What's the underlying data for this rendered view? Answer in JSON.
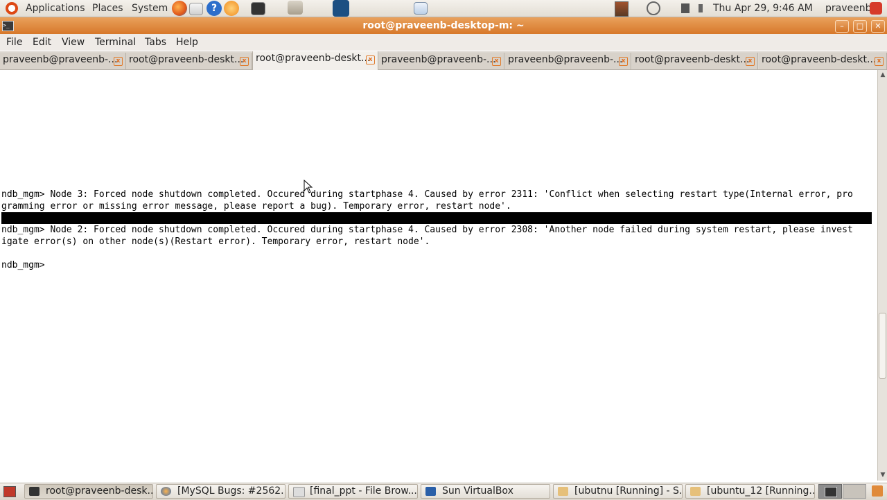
{
  "top_panel": {
    "menus": [
      "Applications",
      "Places",
      "System"
    ],
    "clock": "Thu Apr 29,  9:46 AM",
    "user": "praveenb"
  },
  "window": {
    "title": "root@praveenb-desktop-m: ~"
  },
  "menubar": [
    "File",
    "Edit",
    "View",
    "Terminal",
    "Tabs",
    "Help"
  ],
  "tabs": [
    {
      "label": "praveenb@praveenb-..."
    },
    {
      "label": "root@praveenb-deskt..."
    },
    {
      "label": "root@praveenb-deskt...",
      "active": true
    },
    {
      "label": "praveenb@praveenb-..."
    },
    {
      "label": "praveenb@praveenb-..."
    },
    {
      "label": "root@praveenb-deskt..."
    },
    {
      "label": "root@praveenb-deskt..."
    }
  ],
  "terminal": {
    "lines": [
      "ndb_mgm> Node 3: Forced node shutdown completed. Occured during startphase 4. Caused by error 2311: 'Conflict when selecting restart type(Internal error, pro",
      "gramming error or missing error message, please report a bug). Temporary error, restart node'.",
      "ndb_mgm> Node 2: Forced node shutdown completed. Occured during startphase 4. Caused by error 2308: 'Another node failed during system restart, please invest",
      "igate error(s) on other node(s)(Restart error). Temporary error, restart node'.",
      "ndb_mgm> "
    ]
  },
  "taskbar": [
    {
      "label": "root@praveenb-desk...",
      "active": true
    },
    {
      "label": "[MySQL Bugs: #2562..."
    },
    {
      "label": "[final_ppt - File Brow..."
    },
    {
      "label": "Sun VirtualBox"
    },
    {
      "label": "[ubutnu [Running] - S..."
    },
    {
      "label": "[ubuntu_12 [Running..."
    }
  ]
}
